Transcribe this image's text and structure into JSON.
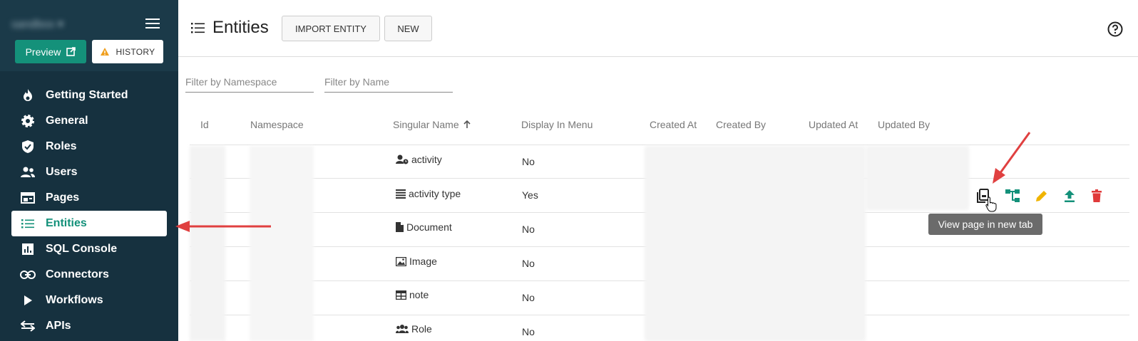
{
  "sidebar": {
    "workspace": "sandbox",
    "preview_label": "Preview",
    "history_label": "HISTORY",
    "items": [
      {
        "label": "Getting Started",
        "icon": "flame-icon"
      },
      {
        "label": "General",
        "icon": "gear-icon"
      },
      {
        "label": "Roles",
        "icon": "shield-icon"
      },
      {
        "label": "Users",
        "icon": "users-icon"
      },
      {
        "label": "Pages",
        "icon": "pages-icon"
      },
      {
        "label": "Entities",
        "icon": "list-icon",
        "active": true
      },
      {
        "label": "SQL Console",
        "icon": "chart-icon"
      },
      {
        "label": "Connectors",
        "icon": "link-icon"
      },
      {
        "label": "Workflows",
        "icon": "play-icon"
      },
      {
        "label": "APIs",
        "icon": "api-icon"
      }
    ]
  },
  "header": {
    "title": "Entities",
    "import_label": "IMPORT ENTITY",
    "new_label": "NEW"
  },
  "filters": {
    "namespace_placeholder": "Filter by Namespace",
    "name_placeholder": "Filter by Name"
  },
  "table": {
    "columns": [
      "Id",
      "Namespace",
      "Singular Name",
      "Display In Menu",
      "Created At",
      "Created By",
      "Updated At",
      "Updated By"
    ],
    "rows": [
      {
        "name": "activity",
        "icon": "user-clock-icon",
        "menu": "No"
      },
      {
        "name": "activity type",
        "icon": "list-lines-icon",
        "menu": "Yes"
      },
      {
        "name": "Document",
        "icon": "document-icon",
        "menu": "No"
      },
      {
        "name": "Image",
        "icon": "image-icon",
        "menu": "No"
      },
      {
        "name": "note",
        "icon": "table-icon",
        "menu": "No"
      },
      {
        "name": "Role",
        "icon": "users-icon",
        "menu": "No"
      }
    ]
  },
  "tooltip": "View page in new tab",
  "colors": {
    "sidebar": "#16313f",
    "accent": "#14917a",
    "warning": "#f0b400",
    "danger": "#e03a3a",
    "arrow": "#e04040"
  }
}
